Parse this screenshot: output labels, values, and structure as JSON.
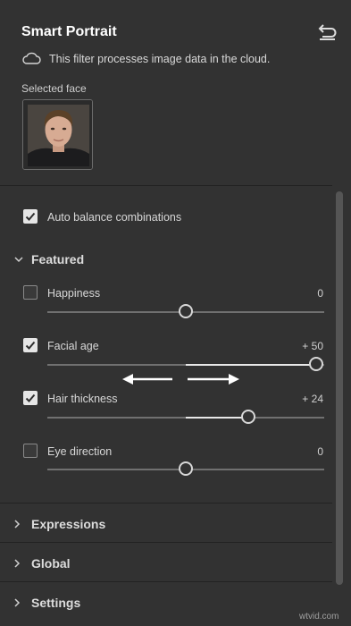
{
  "panel": {
    "title": "Smart Portrait",
    "cloud_note": "This filter processes image data in the cloud.",
    "selected_face_label": "Selected face"
  },
  "auto_balance": {
    "label": "Auto balance combinations",
    "checked": true
  },
  "featured": {
    "label": "Featured",
    "expanded": true,
    "sliders": [
      {
        "label": "Happiness",
        "value": "0",
        "checked": false,
        "level": 0
      },
      {
        "label": "Facial age",
        "value": "+ 50",
        "checked": true,
        "level": 50
      },
      {
        "label": "Hair thickness",
        "value": "+ 24",
        "checked": true,
        "level": 24
      },
      {
        "label": "Eye direction",
        "value": "0",
        "checked": false,
        "level": 0
      }
    ]
  },
  "sections": [
    {
      "label": "Expressions"
    },
    {
      "label": "Global"
    },
    {
      "label": "Settings"
    }
  ],
  "watermark": "wtvid.com",
  "colors": {
    "background": "#323232",
    "checkbox_on": "#e6e6e6",
    "slider_fill": "#e8e8e8"
  },
  "icons": [
    "reset-icon",
    "cloud-icon",
    "checkmark-icon",
    "chevron-down-icon",
    "chevron-right-icon",
    "arrow-left-icon",
    "arrow-right-icon"
  ]
}
